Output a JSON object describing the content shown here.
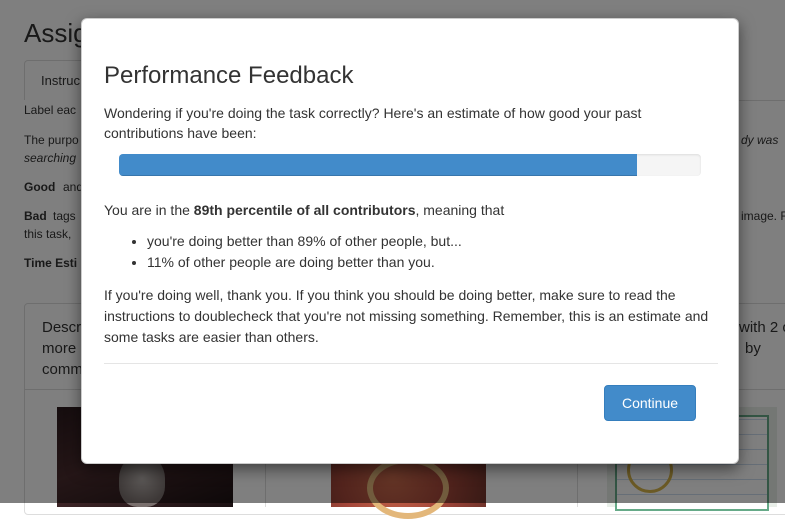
{
  "background": {
    "page_title": "Assig",
    "tab_label": "Instruc",
    "lines": [
      {
        "text": "Label eac",
        "style": "normal"
      },
      {
        "text": "The purpo",
        "style": "normal"
      },
      {
        "text": "searching",
        "style": "italic"
      },
      {
        "text": "Good",
        "style": "bold"
      },
      {
        "text": "and",
        "style": "normal"
      },
      {
        "text": "Bad",
        "style": "bold"
      },
      {
        "text": "tags",
        "style": "normal"
      },
      {
        "text": "this task,",
        "style": "normal"
      },
      {
        "text": "Time Esti",
        "style": "bold"
      },
      {
        "text": "dy was",
        "style": "italic"
      },
      {
        "text": "image. F",
        "style": "normal"
      }
    ],
    "panel_header_left": [
      "Descr",
      "more",
      "comm"
    ],
    "panel_header_right": [
      "with 2 o",
      "by"
    ]
  },
  "modal": {
    "title": "Performance Feedback",
    "intro": "Wondering if you're doing the task correctly? Here's an estimate of how good your past contributions have been:",
    "progress_fraction": 0.89,
    "progress_color": "#428bca",
    "percentile_prefix": "You are in the ",
    "percentile_bold": "89th percentile of all contributors",
    "percentile_suffix": ", meaning that",
    "bullets": [
      "you're doing better than 89% of other people, but...",
      "11% of other people are doing better than you."
    ],
    "outro": "If you're doing well, thank you. If you think you should be doing better, make sure to read the instructions to doublecheck that you're not missing something. Remember, this is an estimate and some tasks are easier than others.",
    "continue_label": "Continue"
  }
}
